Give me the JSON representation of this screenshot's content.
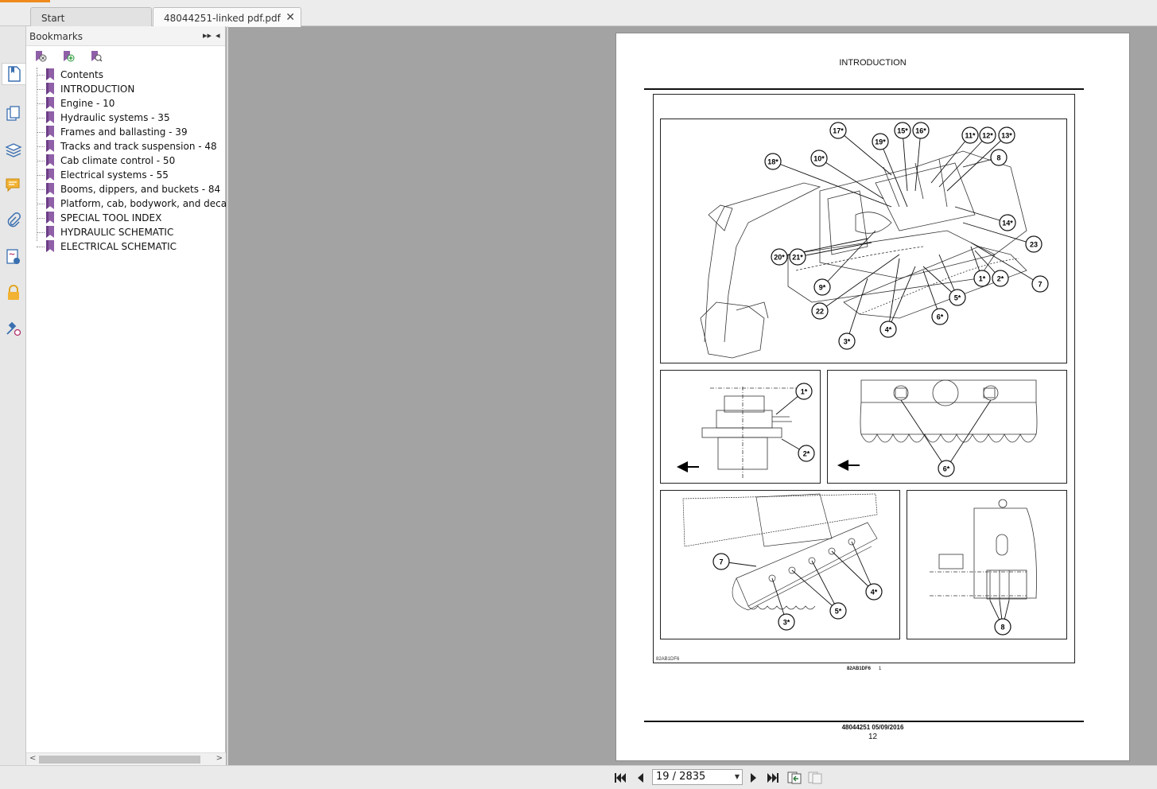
{
  "tabs": [
    {
      "label": "Start"
    },
    {
      "label": "48044251-linked pdf.pdf",
      "close": "✕"
    }
  ],
  "bookmarks_panel": {
    "title": "Bookmarks",
    "items": [
      {
        "label": "Contents"
      },
      {
        "label": "INTRODUCTION"
      },
      {
        "label": "Engine - 10"
      },
      {
        "label": "Hydraulic systems - 35"
      },
      {
        "label": "Frames and ballasting - 39"
      },
      {
        "label": "Tracks and track suspension - 48"
      },
      {
        "label": "Cab climate control - 50"
      },
      {
        "label": "Electrical systems - 55"
      },
      {
        "label": "Booms, dippers, and buckets - 84"
      },
      {
        "label": "Platform, cab, bodywork, and decals -"
      },
      {
        "label": "SPECIAL TOOL INDEX"
      },
      {
        "label": "HYDRAULIC SCHEMATIC"
      },
      {
        "label": "ELECTRICAL SCHEMATIC"
      }
    ]
  },
  "page": {
    "header": "INTRODUCTION",
    "figure_code": "82AB1DF6",
    "caption_code": "82AB1DF6",
    "caption_num": "1",
    "doc_ref": "48044251 05/09/2016",
    "page_number": "12",
    "callouts_main": [
      "17*",
      "15*",
      "16*",
      "19*",
      "11*",
      "12*",
      "13*",
      "18*",
      "10*",
      "8",
      "14*",
      "23",
      "20*",
      "21*",
      "1*",
      "2*",
      "7",
      "9*",
      "5*",
      "22",
      "6*",
      "4*",
      "3*"
    ],
    "callouts_p2": [
      "1*",
      "2*"
    ],
    "callouts_p3": [
      "6*"
    ],
    "callouts_p4": [
      "7",
      "4*",
      "5*",
      "3*"
    ],
    "callouts_p5": [
      "8"
    ]
  },
  "nav": {
    "page_indicator": "19 / 2835"
  },
  "colors": {
    "accent": "#f08a1c",
    "bookmark": "#8f5fa8",
    "viewer_bg": "#a3a3a3"
  }
}
